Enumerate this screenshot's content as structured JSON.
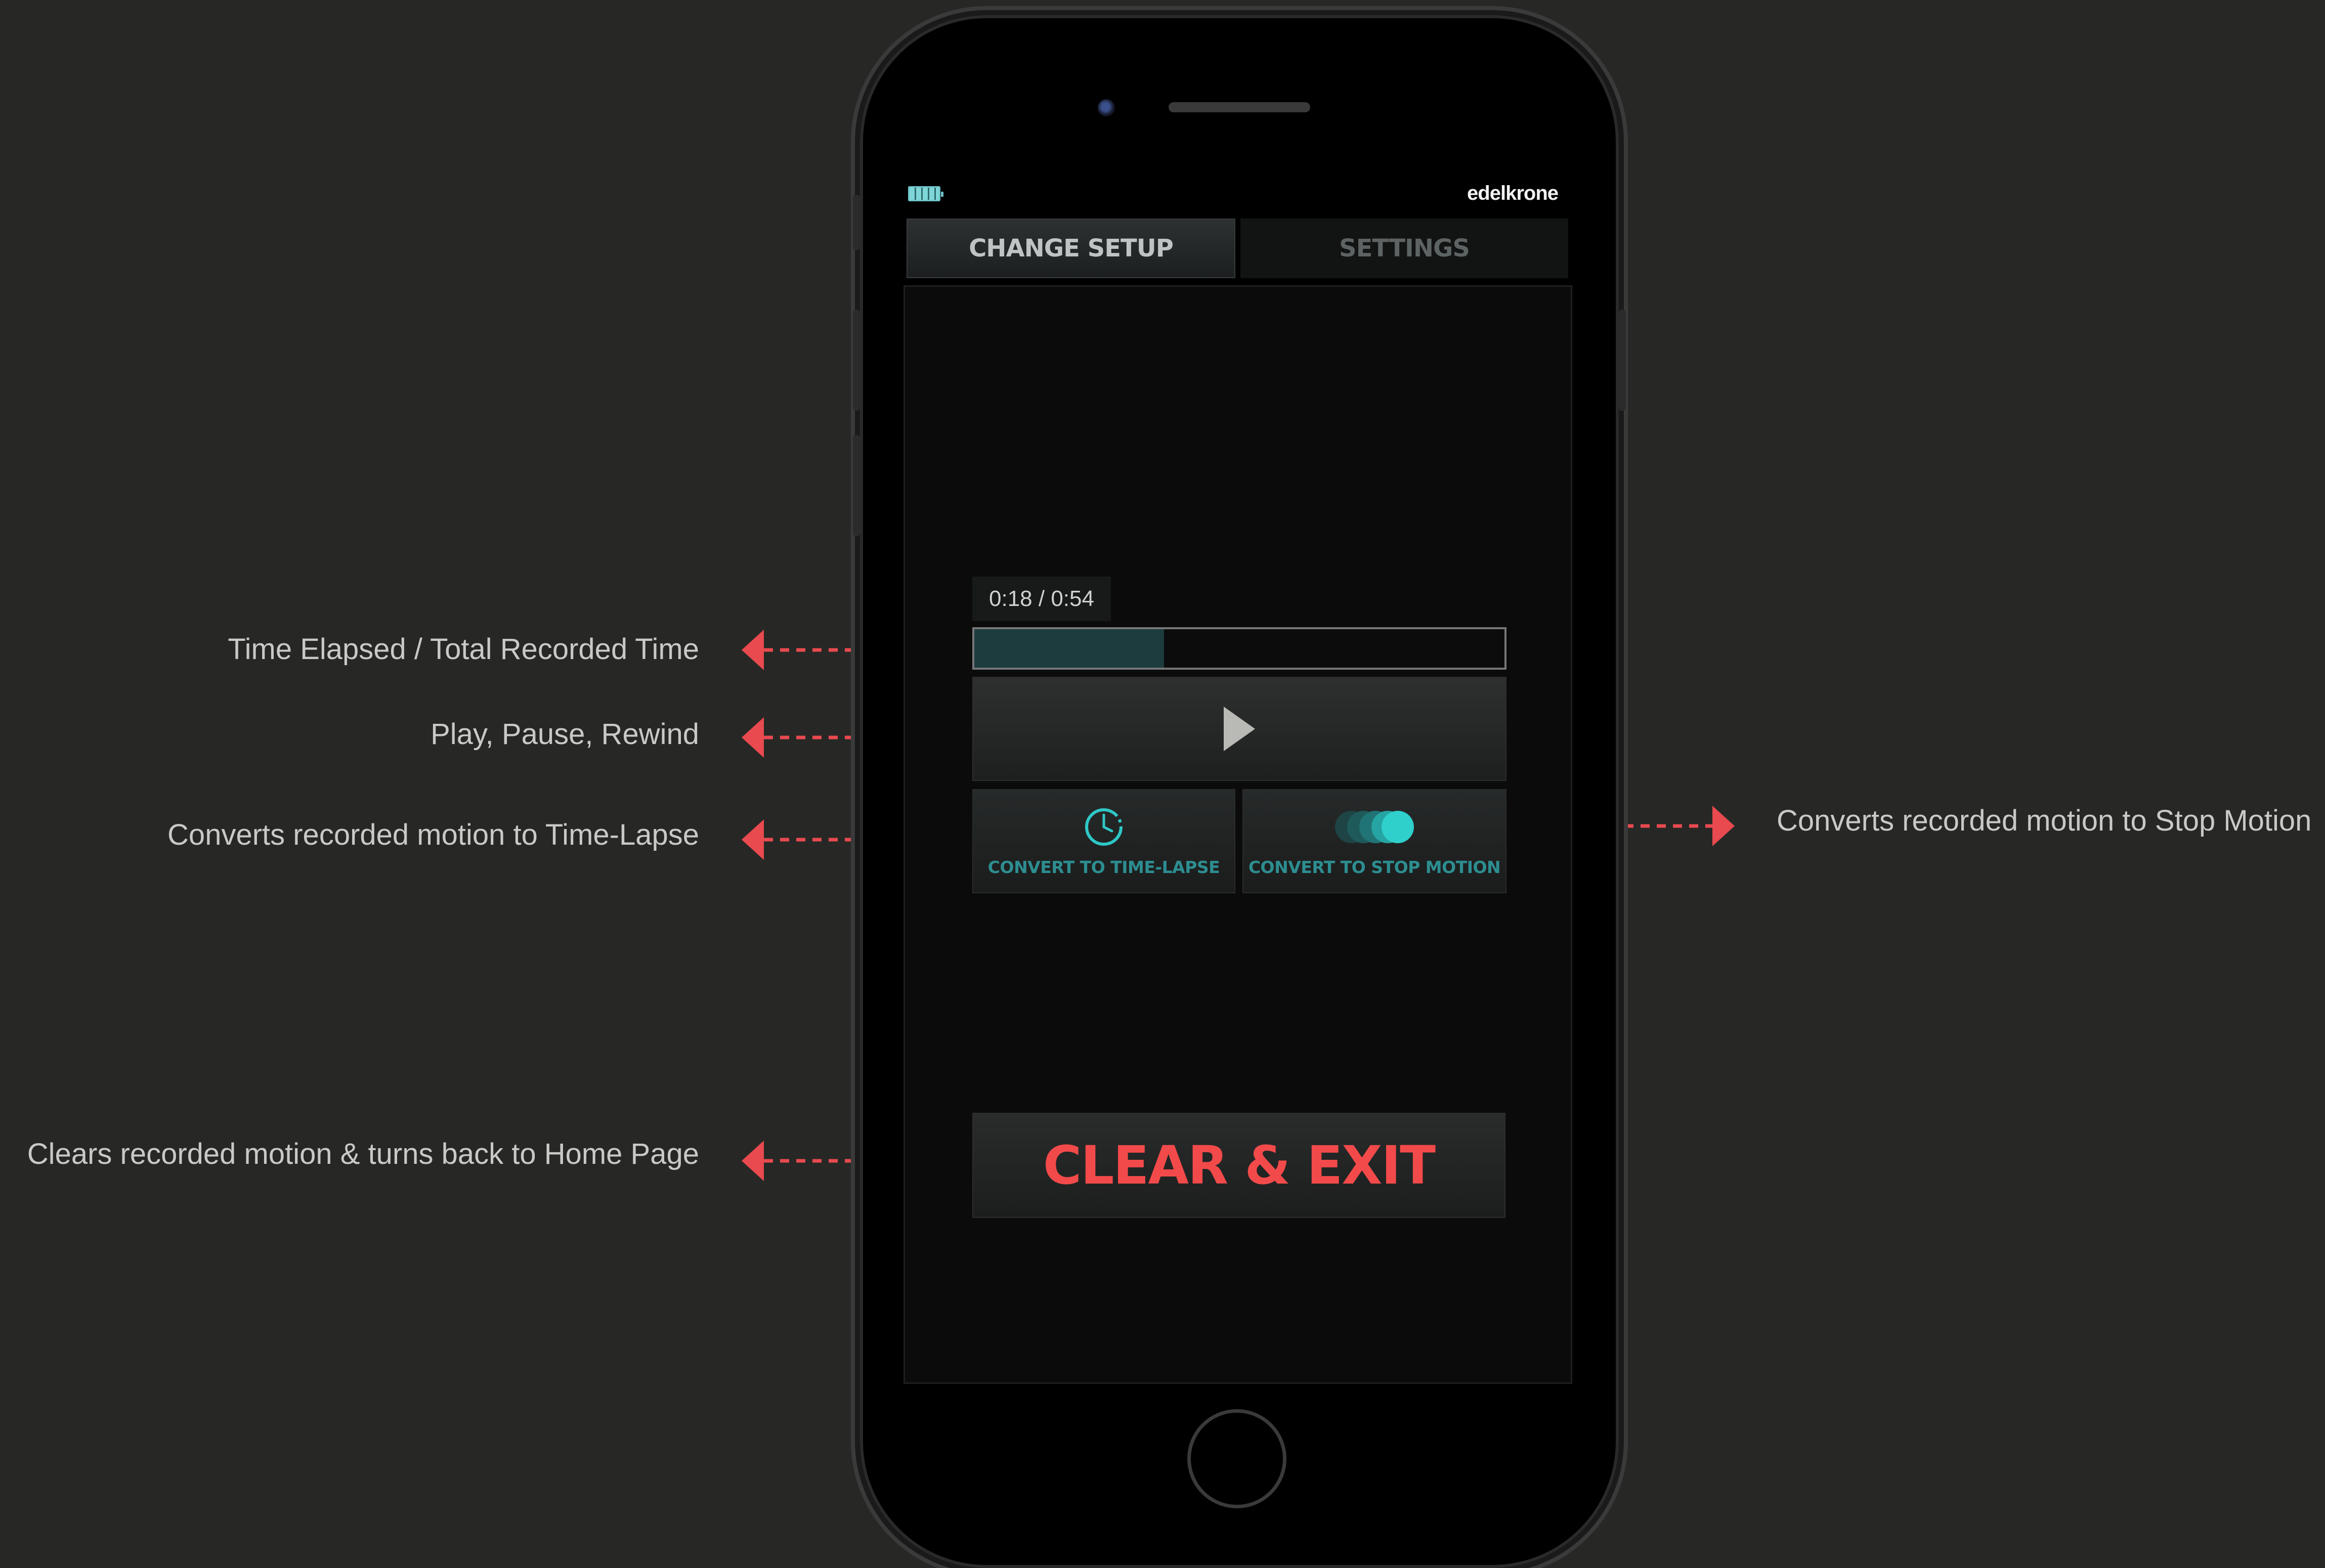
{
  "annotations": {
    "time_elapsed": "Time Elapsed / Total Recorded Time",
    "play_pause": "Play, Pause, Rewind",
    "convert_timelapse": "Converts recorded motion to Time-Lapse",
    "clear_exit": "Clears recorded motion  & turns back to Home Page",
    "convert_stopmotion": "Converts recorded motion to Stop Motion"
  },
  "app": {
    "brand": "edelkrone",
    "tabs": [
      {
        "label": "CHANGE SETUP",
        "active": true
      },
      {
        "label": "SETTINGS",
        "active": false
      }
    ],
    "playback": {
      "time_display": "0:18 / 0:54",
      "progress_fraction": 0.358
    },
    "buttons": {
      "timelapse": "CONVERT TO TIME-LAPSE",
      "stopmotion": "CONVERT TO STOP MOTION",
      "clear_exit": "CLEAR & EXIT"
    }
  },
  "icons": {
    "battery": "battery-full-icon",
    "play": "play-icon",
    "clock": "clock-icon",
    "stop_motion": "stop-motion-icon",
    "arrow": "arrow-icon"
  },
  "colors": {
    "background": "#272826",
    "accent_teal": "#2d8e91",
    "accent_red": "#f24a4a",
    "annotation_arrow": "#e84a4f"
  }
}
